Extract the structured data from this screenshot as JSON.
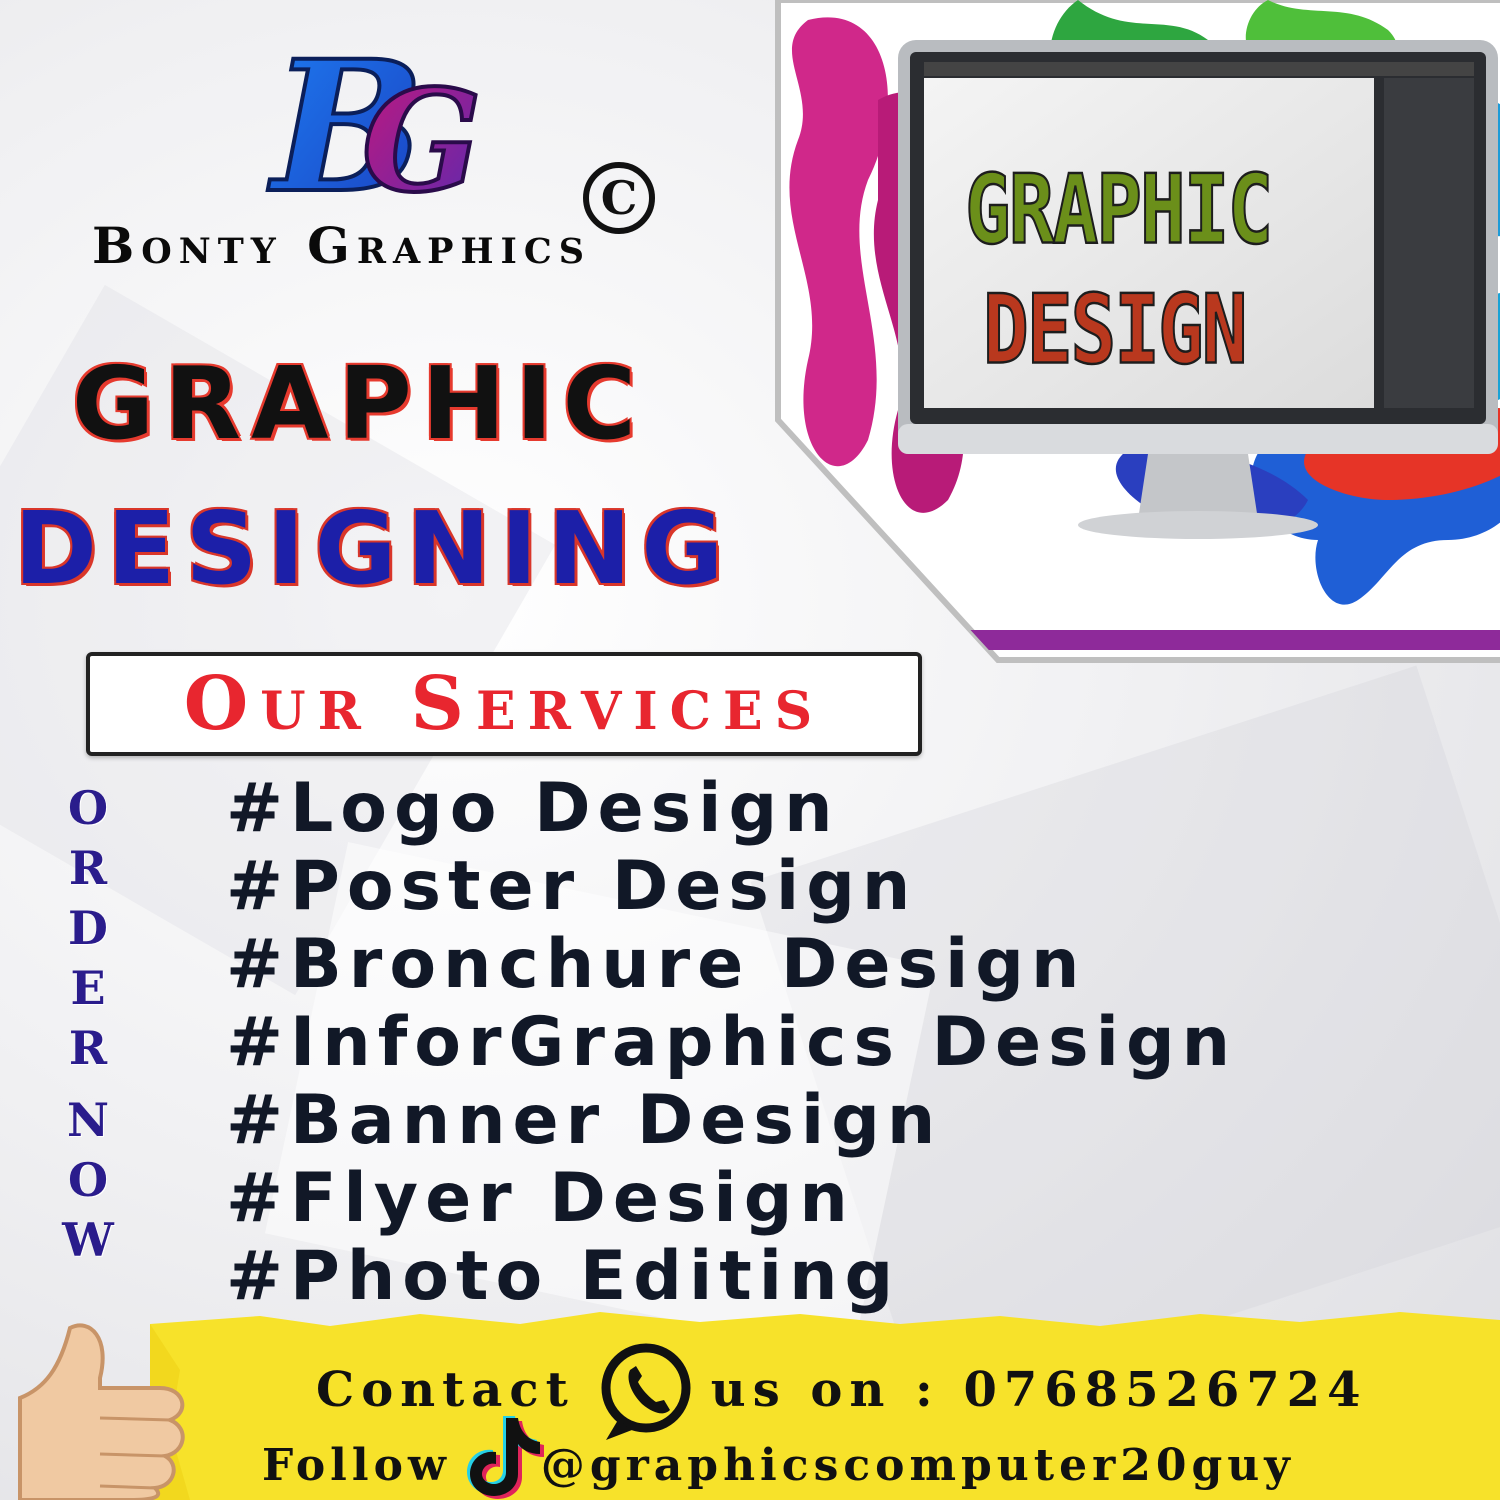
{
  "brand": {
    "monogram": "BG",
    "name": "Bonty Graphics",
    "copyright_symbol": "C"
  },
  "headline": {
    "line1": "GRAPHIC",
    "line2": "DESIGNING"
  },
  "hero": {
    "screen_line1": "GRAPHIC",
    "screen_line2": "DESIGN"
  },
  "services": {
    "title": "Our Services",
    "items": [
      "#Logo Design",
      "#Poster Design",
      "#Bronchure Design",
      "#InforGraphics Design",
      "#Banner Design",
      "#Flyer Design",
      "#Photo Editing"
    ]
  },
  "order_now": [
    "O",
    "R",
    "D",
    "E",
    "R",
    " ",
    "N",
    "O",
    "W"
  ],
  "footer": {
    "contact_label": "Contact",
    "contact_suffix": "us on : 0768526724",
    "follow_label": "Follow",
    "handle": "@graphicscomputer20guy",
    "band_color": "#f7e22a"
  },
  "icons": {
    "whatsapp": "whatsapp-icon",
    "tiktok": "tiktok-icon",
    "thumbs_up": "thumbs-up-icon"
  }
}
